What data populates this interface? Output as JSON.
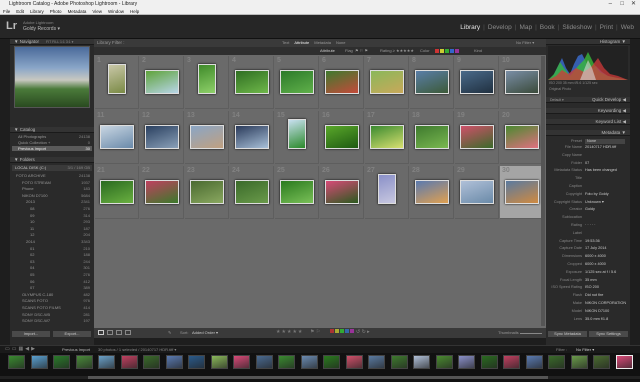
{
  "window": {
    "title": "Lightroom Catalog - Adobe Photoshop Lightroom - Library"
  },
  "menu": [
    "File",
    "Edit",
    "Library",
    "Photo",
    "Metadata",
    "View",
    "Window",
    "Help"
  ],
  "identity": {
    "logo": "Lr",
    "line1": "Adobe Lightroom",
    "line2": "Goldy Records ▾"
  },
  "modules": [
    "Library",
    "Develop",
    "Map",
    "Book",
    "Slideshow",
    "Print",
    "Web"
  ],
  "navigator": {
    "title": "Navigator",
    "zoom": "FIT  FILL  1:1  3:1 ▾"
  },
  "catalog": {
    "title": "Catalog",
    "items": [
      {
        "label": "All Photographs",
        "count": "24138"
      },
      {
        "label": "Quick Collection +",
        "count": "0"
      },
      {
        "label": "Previous Import",
        "count": "30"
      }
    ]
  },
  "folders": {
    "title": "Folders",
    "volume": "LOCAL DISK (C:)",
    "volume_size": "3/1 / 169 GB",
    "items": [
      {
        "label": "FOTO ARCHIVE",
        "count": "24138"
      },
      {
        "label": "FOTO STREAM",
        "count": "1937"
      },
      {
        "label": "Phone",
        "count": "183"
      },
      {
        "label": "NIKON D7100",
        "count": "5684"
      },
      {
        "label": "2013",
        "count": "2341"
      },
      {
        "label": "08",
        "count": "276"
      },
      {
        "label": "09",
        "count": "314"
      },
      {
        "label": "10",
        "count": "293"
      },
      {
        "label": "11",
        "count": "187"
      },
      {
        "label": "12",
        "count": "204"
      },
      {
        "label": "2014",
        "count": "3343"
      },
      {
        "label": "01",
        "count": "210"
      },
      {
        "label": "02",
        "count": "188"
      },
      {
        "label": "03",
        "count": "244"
      },
      {
        "label": "04",
        "count": "301"
      },
      {
        "label": "05",
        "count": "276"
      },
      {
        "label": "06",
        "count": "412"
      },
      {
        "label": "07",
        "count": "389"
      },
      {
        "label": "OLYMPUS C-180",
        "count": "482"
      },
      {
        "label": "SCANS FOTO",
        "count": "976"
      },
      {
        "label": "SCANS FOTO FILMS",
        "count": "414"
      },
      {
        "label": "SONY DSC-W5",
        "count": "281"
      },
      {
        "label": "SONY DSC-W7",
        "count": "197"
      }
    ],
    "import": "Import...",
    "export": "Export..."
  },
  "filterbar": {
    "title": "Library Filter :",
    "tabs": [
      "Text",
      "Attribute",
      "Metadata",
      "None"
    ],
    "filter_off": "No Filter ▾",
    "attribute": "Attribute",
    "flag": "Flag",
    "rating": "Rating ≥ ★★★★★",
    "color": "Color",
    "kind": "Kind"
  },
  "grid": {
    "numbers": [
      "1",
      "2",
      "3",
      "4",
      "5",
      "6",
      "7",
      "8",
      "9",
      "10",
      "11",
      "12",
      "13",
      "14",
      "15",
      "16",
      "17",
      "18",
      "19",
      "20",
      "21",
      "22",
      "23",
      "24",
      "25",
      "26",
      "27",
      "28",
      "29",
      "30"
    ],
    "thumbs": [
      {
        "c1": "#c9c7a8",
        "c2": "#7a8a45",
        "portrait": true
      },
      {
        "c1": "#5fa33b",
        "c2": "#b8d5e8",
        "portrait": false
      },
      {
        "c1": "#3f8a2a",
        "c2": "#8fd16a",
        "portrait": true
      },
      {
        "c1": "#2f6e22",
        "c2": "#6fb84a",
        "portrait": false
      },
      {
        "c1": "#2c7a2a",
        "c2": "#60b04a",
        "portrait": false
      },
      {
        "c1": "#3e7a2e",
        "c2": "#c44a3a",
        "portrait": false
      },
      {
        "c1": "#8ab85a",
        "c2": "#c9a85a",
        "portrait": false
      },
      {
        "c1": "#5a7ea8",
        "c2": "#3c5a38",
        "portrait": false
      },
      {
        "c1": "#4a6a8a",
        "c2": "#203040",
        "portrait": false
      },
      {
        "c1": "#7a8ea6",
        "c2": "#3a4a3a",
        "portrait": false
      },
      {
        "c1": "#c9d6e2",
        "c2": "#6a8aaa",
        "portrait": false
      },
      {
        "c1": "#2a4060",
        "c2": "#8aa0b8",
        "portrait": false
      },
      {
        "c1": "#8aa6c6",
        "c2": "#c0a080",
        "portrait": false
      },
      {
        "c1": "#2a3a5a",
        "c2": "#a8c0d8",
        "portrait": false
      },
      {
        "c1": "#c8e0f0",
        "c2": "#2a8a2a",
        "portrait": true
      },
      {
        "c1": "#5aa82a",
        "c2": "#1e5a12",
        "portrait": false
      },
      {
        "c1": "#3a8a30",
        "c2": "#d8e070",
        "portrait": false
      },
      {
        "c1": "#3e7a2e",
        "c2": "#7ab850",
        "portrait": false
      },
      {
        "c1": "#d0506a",
        "c2": "#3a6a2a",
        "portrait": false
      },
      {
        "c1": "#4a8a30",
        "c2": "#e07080",
        "portrait": false
      },
      {
        "c1": "#2a6a20",
        "c2": "#6ab040",
        "portrait": false
      },
      {
        "c1": "#c04060",
        "c2": "#3a7a2a",
        "portrait": false
      },
      {
        "c1": "#4a6a30",
        "c2": "#8aa860",
        "portrait": false
      },
      {
        "c1": "#3a6a2a",
        "c2": "#6a9a4a",
        "portrait": false
      },
      {
        "c1": "#2a7a1e",
        "c2": "#7ac058",
        "portrait": false
      },
      {
        "c1": "#d84a78",
        "c2": "#2a5a1e",
        "portrait": false
      },
      {
        "c1": "#8a90c8",
        "c2": "#c8c8e0",
        "portrait": true
      },
      {
        "c1": "#5a7ab0",
        "c2": "#e0a050",
        "portrait": false
      },
      {
        "c1": "#b0c0d8",
        "c2": "#6a8aa8",
        "portrait": false
      },
      {
        "c1": "#5a7aa0",
        "c2": "#d08a40",
        "portrait": false
      },
      {
        "c1": "#4a6a90",
        "c2": "#e8c080",
        "portrait": false
      },
      {
        "c1": "#6a8ab0",
        "c2": "#3a6a2a",
        "portrait": false
      }
    ]
  },
  "bottombar": {
    "sort_label": "Sort:",
    "sort_value": "Added Order ▾",
    "thumbnails": "Thumbnails"
  },
  "histogram": {
    "title": "Histogram",
    "info": "ISO 200  35 mm  f/5.6  1/125 sec",
    "original": "Original Photo"
  },
  "quickdevelop": {
    "saved": "Default ▾",
    "title": "Quick Develop"
  },
  "keywording": {
    "title": "Keywording"
  },
  "keywordlist": {
    "title": "Keyword List"
  },
  "metadata": {
    "title": "Metadata",
    "preset_label": "Preset",
    "preset_value": "None",
    "rows": [
      {
        "label": "File Name",
        "value": "20140717 HDR.tiff"
      },
      {
        "label": "Copy Name",
        "value": ""
      },
      {
        "label": "Folder",
        "value": "07"
      },
      {
        "label": "Metadata Status",
        "value": "Has been changed"
      },
      {
        "label": "Title",
        "value": ""
      },
      {
        "label": "Caption",
        "value": ""
      },
      {
        "label": "Copyright",
        "value": "Foto by Goldy"
      },
      {
        "label": "Copyright Status",
        "value": "Unknown ▾"
      },
      {
        "label": "Creator",
        "value": "Goldy"
      },
      {
        "label": "Sublocation",
        "value": ""
      },
      {
        "label": "Rating",
        "value": "· · · · ·"
      },
      {
        "label": "Label",
        "value": ""
      },
      {
        "label": "Capture Time",
        "value": "19:53:36"
      },
      {
        "label": "Capture Date",
        "value": "17 July 2014"
      },
      {
        "label": "Dimensions",
        "value": "6000 x 4000"
      },
      {
        "label": "Cropped",
        "value": "6000 x 4000"
      },
      {
        "label": "Exposure",
        "value": "1/125 sec at f / 5.6"
      },
      {
        "label": "Focal Length",
        "value": "35 mm"
      },
      {
        "label": "ISO Speed Rating",
        "value": "ISO 200"
      },
      {
        "label": "Flash",
        "value": "Did not fire"
      },
      {
        "label": "Make",
        "value": "NIKON CORPORATION"
      },
      {
        "label": "Model",
        "value": "NIKON D7100"
      },
      {
        "label": "Lens",
        "value": "35.0 mm f/1.8"
      }
    ],
    "sync_metadata": "Sync Metadata",
    "sync_settings": "Sync Settings"
  },
  "filmstrip": {
    "source": "Previous Import",
    "status": "30 photos / 1 selected / 20140717 HDR.tiff ▾",
    "filter_label": "Filter :",
    "filter_value": "No Filter ▾",
    "colors": [
      "#3a8a30",
      "#5aa0d0",
      "#2a7a2a",
      "#4a8a3a",
      "#6aa0c8",
      "#c04060",
      "#3a6a2a",
      "#5a7ab0",
      "#2a5a8a",
      "#8ab85a",
      "#d84a78",
      "#4a6a90",
      "#3a8a30",
      "#6a8ab0",
      "#2a7a1e",
      "#d0506a",
      "#5a7aa0",
      "#3e7a2e",
      "#b0c0d8",
      "#4a8a30",
      "#8a90c8",
      "#2a6a20",
      "#c04060",
      "#5a7ab0",
      "#3a6a2a",
      "#6a9a4a",
      "#4a6a30",
      "#d84a78"
    ]
  },
  "colors": {
    "accent": "#e6e6e6",
    "selected_cell": "#a5a5a5",
    "cell": "#6a6a6a",
    "panel": "#2a2a2a"
  }
}
